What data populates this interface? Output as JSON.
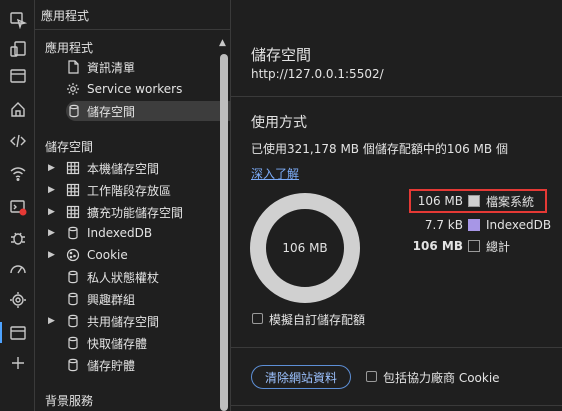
{
  "sidebar": {
    "title": "應用程式",
    "sections": [
      {
        "heading": "應用程式",
        "items": [
          {
            "label": "資訊清單",
            "icon": "file-icon",
            "expandable": false,
            "selected": false
          },
          {
            "label": "Service workers",
            "icon": "gear-icon",
            "expandable": false,
            "selected": false
          },
          {
            "label": "儲存空間",
            "icon": "database-icon",
            "expandable": false,
            "selected": true
          }
        ]
      },
      {
        "heading": "儲存空間",
        "items": [
          {
            "label": "本機儲存空間",
            "icon": "grid-icon",
            "expandable": true
          },
          {
            "label": "工作階段存放區",
            "icon": "grid-icon",
            "expandable": true
          },
          {
            "label": "擴充功能儲存空間",
            "icon": "grid-icon",
            "expandable": true
          },
          {
            "label": "IndexedDB",
            "icon": "database-icon",
            "expandable": true
          },
          {
            "label": "Cookie",
            "icon": "cookie-icon",
            "expandable": true
          },
          {
            "label": "私人狀態權杖",
            "icon": "database-icon",
            "expandable": false
          },
          {
            "label": "興趣群組",
            "icon": "database-icon",
            "expandable": false
          },
          {
            "label": "共用儲存空間",
            "icon": "database-icon",
            "expandable": true
          },
          {
            "label": "快取儲存體",
            "icon": "database-icon",
            "expandable": false
          },
          {
            "label": "儲存貯體",
            "icon": "database-icon",
            "expandable": false
          }
        ]
      },
      {
        "heading": "背景服務",
        "items": []
      }
    ]
  },
  "main": {
    "title": "儲存空間",
    "url": "http://127.0.0.1:5502/",
    "usage_heading": "使用方式",
    "usage_text": "已使用321,178 MB 個儲存配額中的106 MB 個",
    "learn_more": "深入了解",
    "donut_label": "106 MB",
    "legend": [
      {
        "value": "106 MB",
        "label": "檔案系統",
        "color": "#d0d0d0"
      },
      {
        "value": "7.7 kB",
        "label": "IndexedDB",
        "color": "#a796e6"
      },
      {
        "value": "106 MB",
        "label": "總計",
        "color": "#1f1f1f"
      }
    ],
    "simulate_quota": "模擬自訂儲存配額",
    "clear_button": "清除網站資料",
    "include_cookies": "包括協力廠商 Cookie"
  },
  "chart_data": {
    "type": "pie",
    "categories": [
      "檔案系統",
      "IndexedDB"
    ],
    "values": [
      106,
      0.0077
    ],
    "total": 106
  },
  "colors": {
    "background": "#1f1f1f",
    "text": "#e3e3e3",
    "link": "#7cacf8",
    "accent": "#4ea3ff",
    "highlight_box": "#e53935",
    "donut": "#d0d0d0",
    "indexeddb": "#a796e6"
  },
  "activity_bar": [
    "inspect-icon",
    "device-icon",
    "window-icon",
    "home-icon",
    "code-icon",
    "wifi-icon",
    "console-error-icon",
    "bug-icon",
    "performance-icon",
    "cpu-icon",
    "application-icon",
    "add-icon"
  ]
}
